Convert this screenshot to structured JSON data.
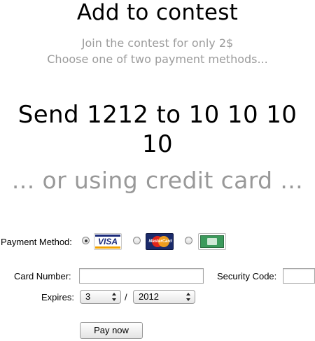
{
  "header": {
    "title": "Add to contest",
    "subtitle_line1": "Join the contest for only 2$",
    "subtitle_line2": "Choose one of two payment methods..."
  },
  "sms": {
    "text": "Send 1212 to 10 10 10 10"
  },
  "credit_card": {
    "heading": "... or using credit card ..."
  },
  "form": {
    "payment_method_label": "Payment Method:",
    "methods": [
      {
        "name": "visa",
        "card_text": "VISA",
        "selected": true
      },
      {
        "name": "mastercard",
        "card_text": "MasterCard",
        "selected": false
      },
      {
        "name": "amex",
        "card_text": "",
        "selected": false
      }
    ],
    "card_number_label": "Card Number:",
    "card_number_value": "",
    "security_code_label": "Security Code:",
    "security_code_value": "",
    "expires_label": "Expires:",
    "expires_month": "3",
    "expires_separator": "/",
    "expires_year": "2012",
    "submit_label": "Pay now"
  },
  "colors": {
    "subtitle_gray": "#9b9b9b",
    "heading_gray": "#999999",
    "visa_blue": "#1a2a7a",
    "mastercard_red": "#e2261b",
    "mastercard_orange": "#f7a21b",
    "amex_green": "#3c9a5c"
  }
}
